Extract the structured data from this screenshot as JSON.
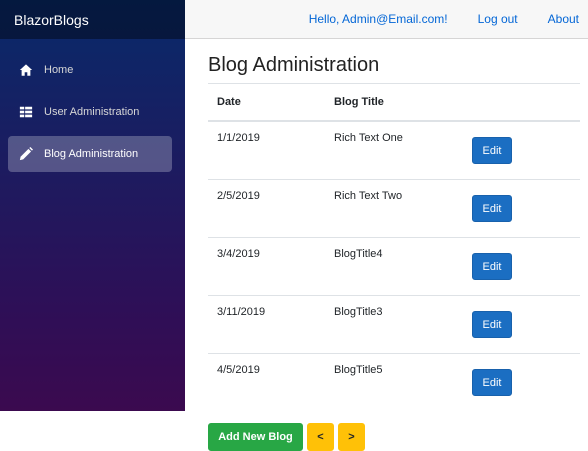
{
  "brand": "BlazorBlogs",
  "header": {
    "greeting": "Hello, Admin@Email.com!",
    "logout": "Log out",
    "about": "About"
  },
  "nav": [
    {
      "label": "Home",
      "icon": "home-icon",
      "active": false
    },
    {
      "label": "User Administration",
      "icon": "list-icon",
      "active": false
    },
    {
      "label": "Blog Administration",
      "icon": "pencil-icon",
      "active": true
    }
  ],
  "page": {
    "title": "Blog Administration",
    "columns": [
      "Date",
      "Blog Title",
      ""
    ],
    "rows": [
      {
        "date": "1/1/2019",
        "title": "Rich Text One",
        "action": "Edit"
      },
      {
        "date": "2/5/2019",
        "title": "Rich Text Two",
        "action": "Edit"
      },
      {
        "date": "3/4/2019",
        "title": "BlogTitle4",
        "action": "Edit"
      },
      {
        "date": "3/11/2019",
        "title": "BlogTitle3",
        "action": "Edit"
      },
      {
        "date": "4/5/2019",
        "title": "BlogTitle5",
        "action": "Edit"
      }
    ],
    "add_button": "Add New Blog",
    "prev_button": "<",
    "next_button": ">"
  },
  "colors": {
    "primary": "#1b6ec2",
    "success": "#28a745",
    "warning": "#ffc107",
    "link": "#0366d6"
  }
}
